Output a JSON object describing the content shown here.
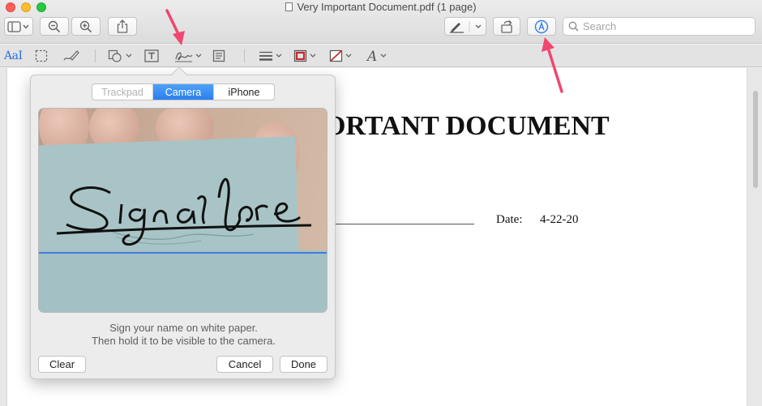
{
  "window": {
    "title": "Very Important Document.pdf (1 page)"
  },
  "toolbar": {
    "search_placeholder": "Search"
  },
  "document": {
    "heading": "ORTANT DOCUMENT",
    "date_label": "Date:",
    "date_value": "4-22-20"
  },
  "markup": {
    "text_tool_label": "AaI"
  },
  "signature_popover": {
    "tabs": [
      {
        "label": "Trackpad",
        "state": "disabled"
      },
      {
        "label": "Camera",
        "state": "selected"
      },
      {
        "label": "iPhone",
        "state": "normal"
      }
    ],
    "instructions_line1": "Sign your name on white paper.",
    "instructions_line2": "Then hold it to be visible to the camera.",
    "clear_label": "Clear",
    "cancel_label": "Cancel",
    "done_label": "Done"
  },
  "colors": {
    "accent": "#2d7ef0",
    "annotation_arrow": "#f0466f"
  }
}
